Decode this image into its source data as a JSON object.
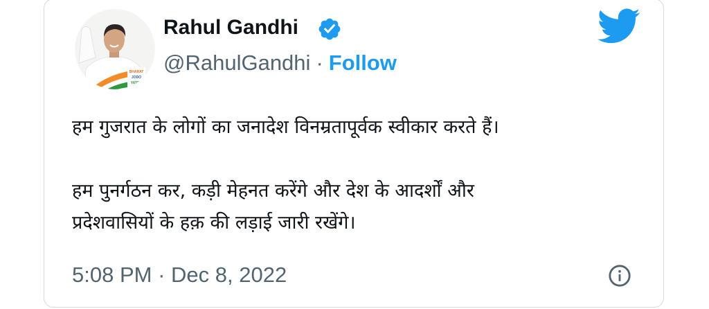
{
  "author": {
    "name": "Rahul Gandhi",
    "handle": "@RahulGandhi",
    "separator": "·",
    "follow_label": "Follow",
    "verified": true,
    "avatar_badge": [
      "BHARAT",
      "JODO",
      "YATRA"
    ]
  },
  "tweet": {
    "lines": [
      "हम गुजरात के लोगों का जनादेश विनम्रतापूर्वक स्वीकार करते हैं।",
      "हम पुनर्गठन कर, कड़ी मेहनत करेंगे और देश के आदर्शों और",
      "प्रदेशवासियों के हक़ की लड़ाई जारी रखेंगे।"
    ],
    "time": "5:08 PM",
    "separator": "·",
    "date": "Dec 8, 2022"
  },
  "icons": {
    "verified": "verified-badge-icon",
    "brand": "twitter-bird-icon",
    "info": "info-icon"
  },
  "colors": {
    "brand_blue": "#1d9bf0",
    "text_primary": "#0f1419",
    "text_secondary": "#536471"
  }
}
